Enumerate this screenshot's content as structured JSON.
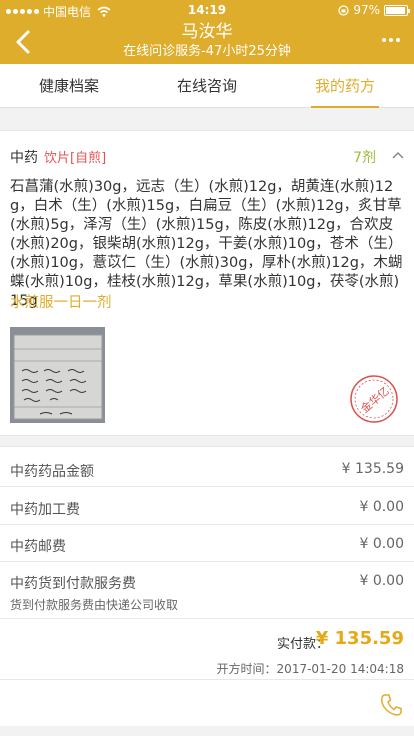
{
  "status_bar": {
    "carrier": "中国电信",
    "time": "14:19",
    "battery": "97%",
    "battery_level": 0.97
  },
  "header": {
    "title": "马汝华",
    "subtitle": "在线问诊服务-47小时25分钟"
  },
  "tabs": [
    {
      "label": "健康档案"
    },
    {
      "label": "在线咨询"
    },
    {
      "label": "我的药方"
    }
  ],
  "prescription": {
    "type": "中药",
    "form": "饮片[自煎]",
    "count": "7剂",
    "herbs": "石菖蒲(水煎)30g，远志（生）(水煎)12g，胡黄连(水煎)12g，白术（生）(水煎)15g，白扁豆（生）(水煎)12g，炙甘草(水煎)5g，泽泻（生）(水煎)15g，陈皮(水煎)12g，合欢皮(水煎)20g，银柴胡(水煎)12g，干姜(水煎)10g，苍术（生）(水煎)10g，薏苡仁（生）(水煎)30g，厚朴(水煎)12g，木蝴蝶(水煎)10g，桂枝(水煎)12g，草果(水煎)10g，茯苓(水煎)15g",
    "usage": "水煎服一日一剂",
    "stamp_text": "金华亿"
  },
  "fees": {
    "items": [
      {
        "label": "中药药品金额",
        "value": "¥ 135.59"
      },
      {
        "label": "中药加工费",
        "value": "¥ 0.00"
      },
      {
        "label": "中药邮费",
        "value": "¥ 0.00"
      },
      {
        "label": "中药货到付款服务费",
        "value": "¥ 0.00"
      }
    ],
    "note": "货到付款服务费由快递公司收取",
    "total_label": "实付款：",
    "total_value": "¥ 135.59",
    "time_label": "开方时间：",
    "time_value": "2017-01-20 14:04:18"
  },
  "colors": {
    "accent": "#dfad2c",
    "price": "#e6a817",
    "form_red": "#e25555",
    "count_green": "#9bbb3a"
  }
}
